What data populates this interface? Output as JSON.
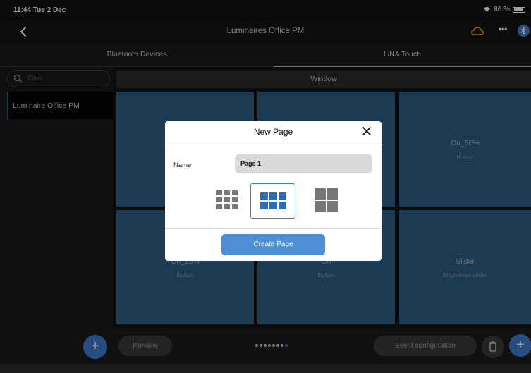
{
  "status_bar": {
    "time": "11:44  Tue 2 Dec",
    "battery": "86 %"
  },
  "nav": {
    "title": "Luminaires Office PM"
  },
  "tabs": [
    {
      "label": "Bluetooth Devices",
      "active": false
    },
    {
      "label": "LiNA Touch",
      "active": true
    }
  ],
  "sidebar": {
    "filter_placeholder": "Filter",
    "items": [
      {
        "label": "Luminaire Office PM",
        "selected": true
      }
    ]
  },
  "main": {
    "window_label": "Window",
    "tiles": [
      {
        "name": "",
        "type": ""
      },
      {
        "name": "",
        "type": ""
      },
      {
        "name": "On_50%",
        "type": "Button"
      },
      {
        "name": "On_25%",
        "type": "Button"
      },
      {
        "name": "On",
        "type": "Button"
      },
      {
        "name": "Slider",
        "type": "Brightness slider"
      }
    ]
  },
  "bottom_bar": {
    "preview_label": "Preview",
    "event_config_label": "Event configuration",
    "page_count": 8,
    "active_page": 8
  },
  "modal": {
    "title": "New Page",
    "name_label": "Name",
    "name_value": "Page 1",
    "layout_options": [
      "grid-3x3-icon",
      "grid-3x2-icon",
      "grid-2x2-icon"
    ],
    "selected_layout": 1,
    "create_label": "Create Page"
  },
  "colors": {
    "accent": "#3f7fd0",
    "tile": "#2e5f86",
    "background": "#121212"
  }
}
